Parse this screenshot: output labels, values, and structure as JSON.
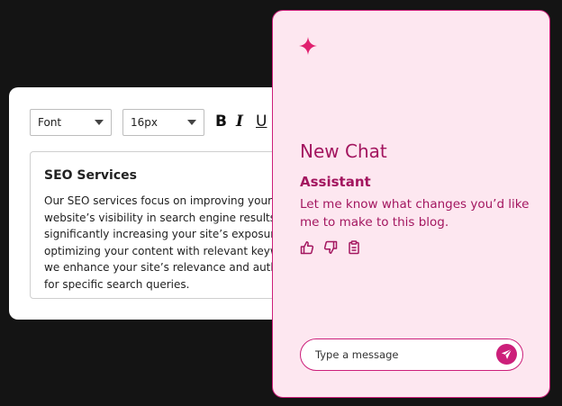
{
  "editor": {
    "font_select": {
      "value": "Font",
      "options": [
        "Font"
      ]
    },
    "size_select": {
      "value": "16px",
      "options": [
        "16px"
      ]
    },
    "format": {
      "bold": "B",
      "italic": "I",
      "underline": "U"
    },
    "document": {
      "title": "SEO Services",
      "lines": [
        "Our SEO services focus on improving your",
        "website’s visibility in search engine results,",
        "significantly increasing your site’s exposure.",
        "optimizing your content with relevant keywo",
        "we enhance your site’s relevance and author",
        "for specific search queries."
      ]
    }
  },
  "chat": {
    "title": "New Chat",
    "assistant_name": "Assistant",
    "message_lines": [
      "Let me know what changes you’d like",
      "me to make to this blog."
    ],
    "actions": [
      "thumbs-up-icon",
      "thumbs-down-icon",
      "clipboard-icon"
    ],
    "input_placeholder": "Type a message",
    "input_value": ""
  },
  "colors": {
    "background": "#141414",
    "accent": "#cc1f7a",
    "accent_text": "#a3165f",
    "chat_panel_bg": "#fde7f0",
    "editor_bg": "#ffffff"
  }
}
